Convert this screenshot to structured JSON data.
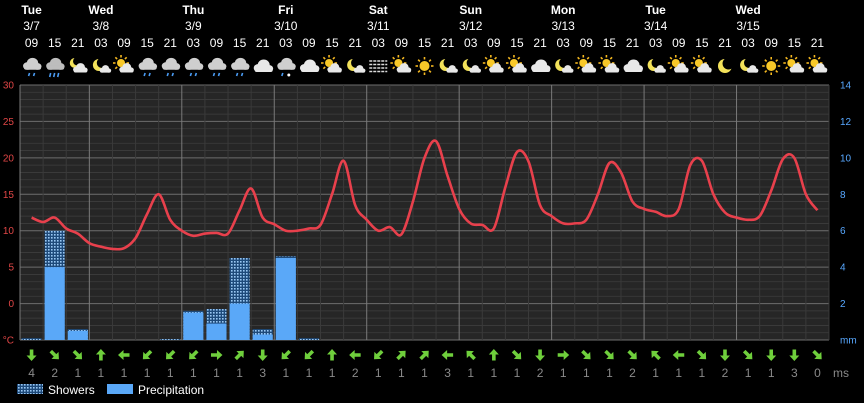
{
  "chart_data": {
    "type": "bar",
    "columns": [
      {
        "day": "Tue",
        "date": "3/7",
        "hour": "09",
        "icon": "cloud-light-rain-icon",
        "wind_dir": "S",
        "wind": "4"
      },
      {
        "day": "",
        "date": "",
        "hour": "15",
        "icon": "cloud-rain-icon",
        "wind_dir": "SE",
        "wind": "2"
      },
      {
        "day": "",
        "date": "",
        "hour": "21",
        "icon": "partly-cloudy-night-icon",
        "wind_dir": "SE",
        "wind": "1"
      },
      {
        "day": "Wed",
        "date": "3/8",
        "hour": "03",
        "icon": "moon-cloud-icon",
        "wind_dir": "N",
        "wind": "1"
      },
      {
        "day": "",
        "date": "",
        "hour": "09",
        "icon": "partly-cloudy-day-icon",
        "wind_dir": "W",
        "wind": "1"
      },
      {
        "day": "",
        "date": "",
        "hour": "15",
        "icon": "cloud-light-rain-icon",
        "wind_dir": "SW",
        "wind": "1"
      },
      {
        "day": "",
        "date": "",
        "hour": "21",
        "icon": "cloud-light-rain-icon",
        "wind_dir": "SW",
        "wind": "1"
      },
      {
        "day": "Thu",
        "date": "3/9",
        "hour": "03",
        "icon": "cloud-light-rain-icon",
        "wind_dir": "SW",
        "wind": "1"
      },
      {
        "day": "",
        "date": "",
        "hour": "09",
        "icon": "cloud-light-rain-icon",
        "wind_dir": "E",
        "wind": "1"
      },
      {
        "day": "",
        "date": "",
        "hour": "15",
        "icon": "cloud-light-rain-icon",
        "wind_dir": "NE",
        "wind": "1"
      },
      {
        "day": "",
        "date": "",
        "hour": "21",
        "icon": "cloud-icon",
        "wind_dir": "S",
        "wind": "3"
      },
      {
        "day": "Fri",
        "date": "3/10",
        "hour": "03",
        "icon": "cloud-sleet-icon",
        "wind_dir": "SW",
        "wind": "1"
      },
      {
        "day": "",
        "date": "",
        "hour": "09",
        "icon": "cloud-icon",
        "wind_dir": "SW",
        "wind": "1"
      },
      {
        "day": "",
        "date": "",
        "hour": "15",
        "icon": "partly-cloudy-day-icon",
        "wind_dir": "N",
        "wind": "1"
      },
      {
        "day": "",
        "date": "",
        "hour": "21",
        "icon": "moon-cloud-icon",
        "wind_dir": "W",
        "wind": "2"
      },
      {
        "day": "Sat",
        "date": "3/11",
        "hour": "03",
        "icon": "fog-icon",
        "wind_dir": "SW",
        "wind": "1"
      },
      {
        "day": "",
        "date": "",
        "hour": "09",
        "icon": "partly-cloudy-day-icon",
        "wind_dir": "NE",
        "wind": "1"
      },
      {
        "day": "",
        "date": "",
        "hour": "15",
        "icon": "sun-icon",
        "wind_dir": "NE",
        "wind": "1"
      },
      {
        "day": "",
        "date": "",
        "hour": "21",
        "icon": "moon-cloud-icon",
        "wind_dir": "W",
        "wind": "3"
      },
      {
        "day": "Sun",
        "date": "3/12",
        "hour": "03",
        "icon": "moon-cloud-icon",
        "wind_dir": "NW",
        "wind": "1"
      },
      {
        "day": "",
        "date": "",
        "hour": "09",
        "icon": "partly-cloudy-day-icon",
        "wind_dir": "N",
        "wind": "1"
      },
      {
        "day": "",
        "date": "",
        "hour": "15",
        "icon": "partly-cloudy-day-icon",
        "wind_dir": "SE",
        "wind": "1"
      },
      {
        "day": "",
        "date": "",
        "hour": "21",
        "icon": "cloud-icon",
        "wind_dir": "S",
        "wind": "2"
      },
      {
        "day": "Mon",
        "date": "3/13",
        "hour": "03",
        "icon": "moon-cloud-icon",
        "wind_dir": "E",
        "wind": "1"
      },
      {
        "day": "",
        "date": "",
        "hour": "09",
        "icon": "partly-cloudy-day-icon",
        "wind_dir": "SE",
        "wind": "1"
      },
      {
        "day": "",
        "date": "",
        "hour": "15",
        "icon": "partly-cloudy-day-icon",
        "wind_dir": "SE",
        "wind": "1"
      },
      {
        "day": "",
        "date": "",
        "hour": "21",
        "icon": "cloud-icon",
        "wind_dir": "SE",
        "wind": "2"
      },
      {
        "day": "Tue",
        "date": "3/14",
        "hour": "03",
        "icon": "moon-cloud-icon",
        "wind_dir": "NW",
        "wind": "1"
      },
      {
        "day": "",
        "date": "",
        "hour": "09",
        "icon": "partly-cloudy-day-icon",
        "wind_dir": "W",
        "wind": "1"
      },
      {
        "day": "",
        "date": "",
        "hour": "15",
        "icon": "partly-cloudy-day-icon",
        "wind_dir": "SE",
        "wind": "1"
      },
      {
        "day": "",
        "date": "",
        "hour": "21",
        "icon": "moon-icon",
        "wind_dir": "S",
        "wind": "2"
      },
      {
        "day": "Wed",
        "date": "3/15",
        "hour": "03",
        "icon": "moon-cloud-icon",
        "wind_dir": "SE",
        "wind": "1"
      },
      {
        "day": "",
        "date": "",
        "hour": "09",
        "icon": "sun-icon",
        "wind_dir": "S",
        "wind": "1"
      },
      {
        "day": "",
        "date": "",
        "hour": "15",
        "icon": "partly-cloudy-day-icon",
        "wind_dir": "S",
        "wind": "3"
      },
      {
        "day": "",
        "date": "",
        "hour": "21",
        "icon": "partly-cloudy-day-icon",
        "wind_dir": "SE",
        "wind": "0"
      }
    ],
    "temperature": {
      "unit": "°C",
      "ylim": [
        -5,
        30
      ],
      "ticks": [
        -5,
        0,
        5,
        10,
        15,
        20,
        25,
        30
      ],
      "tick_labels": [
        "°C",
        "0",
        "5",
        "10",
        "15",
        "20",
        "25",
        "30"
      ],
      "x": [
        0,
        0.5,
        1,
        1.5,
        2,
        2.5,
        3,
        3.5,
        4,
        4.5,
        5,
        5.5,
        6,
        6.5,
        7,
        7.5,
        8,
        8.5,
        9,
        9.5,
        10,
        10.5,
        11,
        11.5,
        12,
        12.5,
        13,
        13.5,
        14,
        14.5,
        15,
        15.5,
        16,
        16.5,
        17,
        17.5,
        18,
        18.5,
        19,
        19.5,
        20,
        20.5,
        21,
        21.5,
        22,
        22.5,
        23,
        23.5,
        24,
        24.5,
        25,
        25.5,
        26,
        26.5,
        27,
        27.5,
        28,
        28.5,
        29,
        29.5,
        30,
        30.5,
        31,
        31.5,
        32,
        32.5,
        33,
        33.5,
        34
      ],
      "values": [
        11.8,
        11.2,
        11.8,
        10.3,
        9.6,
        8.3,
        7.8,
        7.5,
        7.6,
        9.0,
        12.3,
        15.0,
        11.5,
        10.0,
        9.3,
        9.6,
        9.7,
        9.6,
        12.8,
        15.8,
        11.8,
        10.9,
        10.0,
        10.0,
        10.3,
        10.8,
        15.0,
        19.6,
        13.5,
        11.5,
        10.0,
        10.5,
        9.5,
        14.0,
        20.0,
        22.3,
        17.5,
        13.0,
        11.0,
        10.8,
        10.3,
        16.0,
        20.8,
        19.5,
        13.5,
        12.0,
        11.0,
        11.0,
        11.5,
        15.0,
        19.3,
        18.0,
        14.0,
        13.0,
        12.6,
        12.0,
        13.0,
        19.0,
        19.6,
        15.0,
        12.5,
        11.8,
        11.5,
        12.0,
        15.5,
        19.8,
        20.0,
        15.0,
        12.8
      ],
      "color": "#e8404c"
    },
    "precipitation": {
      "unit": "mm",
      "ylim": [
        0,
        14
      ],
      "ticks": [
        0,
        2,
        4,
        6,
        8,
        10,
        12,
        14
      ],
      "tick_labels": [
        "mm",
        "2",
        "4",
        "6",
        "8",
        "10",
        "12",
        "14"
      ],
      "showers": [
        0.1,
        6.0,
        0.6,
        0,
        0,
        0,
        0.05,
        1.6,
        1.7,
        4.5,
        0.6,
        4.6,
        0.1,
        0,
        0,
        0,
        0,
        0,
        0,
        0,
        0,
        0,
        0,
        0,
        0,
        0,
        0,
        0,
        0,
        0,
        0,
        0,
        0,
        0,
        0
      ],
      "precipitation": [
        0,
        4.0,
        0.5,
        0,
        0,
        0,
        0,
        1.5,
        0.9,
        2.0,
        0.3,
        4.5,
        0,
        0,
        0,
        0,
        0,
        0,
        0,
        0,
        0,
        0,
        0,
        0,
        0,
        0,
        0,
        0,
        0,
        0,
        0,
        0,
        0,
        0,
        0
      ],
      "showers_color": "#9ac8f4",
      "precip_color": "#5aa8f8"
    },
    "wind_unit": "ms",
    "legend": [
      {
        "key": "showers",
        "label": "Showers"
      },
      {
        "key": "precipitation",
        "label": "Precipitation"
      }
    ],
    "grid": true,
    "wind_arrow_color": "#6fcf3c"
  }
}
